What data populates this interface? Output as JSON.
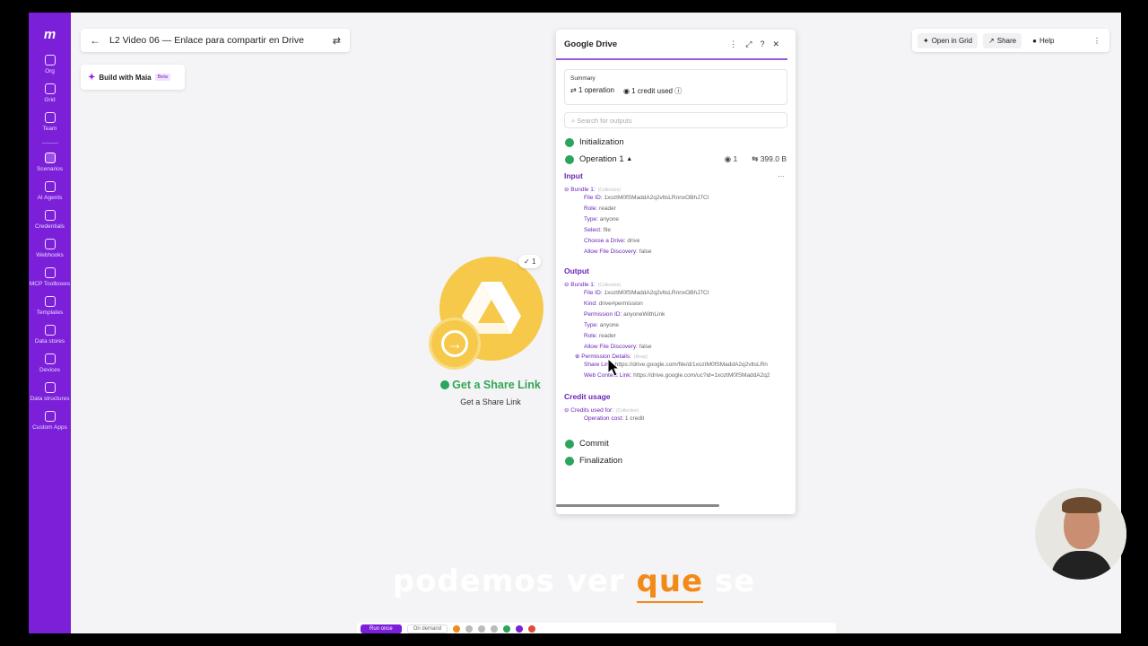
{
  "app": {
    "name": "Make"
  },
  "sidebar": {
    "logo": "m",
    "items": [
      {
        "label": "Org"
      },
      {
        "label": "Grid"
      },
      {
        "label": "Team"
      },
      {
        "label": "Scenarios"
      },
      {
        "label": "AI Agents"
      },
      {
        "label": "Credentials"
      },
      {
        "label": "Webhooks"
      },
      {
        "label": "MCP Toolboxes"
      },
      {
        "label": "Templates"
      },
      {
        "label": "Data stores"
      },
      {
        "label": "Devices"
      },
      {
        "label": "Data structures"
      },
      {
        "label": "Custom Apps"
      }
    ]
  },
  "header": {
    "scenario_title": "L2 Video 06 — Enlace para compartir en Drive",
    "maia_label": "Build with Maia",
    "maia_badge": "Beta",
    "open_in_grid": "Open in Grid",
    "share": "Share",
    "help": "Help"
  },
  "module": {
    "op_count": "1",
    "title": "Get a Share Link",
    "subtitle": "Get a Share Link"
  },
  "panel": {
    "title": "Google Drive",
    "summary_label": "Summary",
    "operations": "1 operation",
    "credits": "1 credit used",
    "search_placeholder": "Search for outputs",
    "initialization": "Initialization",
    "operation_label": "Operation 1",
    "op_views": "1",
    "op_size": "399.0 B",
    "input_label": "Input",
    "input_bundle": "Bundle 1:",
    "input_bundle_type": "(Collection)",
    "input_fields": [
      {
        "k": "File ID:",
        "v": "1xoztM0fSMaddA2q2vltsLRnnxOBhJ7Cl"
      },
      {
        "k": "Role:",
        "v": "reader"
      },
      {
        "k": "Type:",
        "v": "anyone"
      },
      {
        "k": "Select:",
        "v": "file"
      },
      {
        "k": "Choose a Drive:",
        "v": "drive"
      },
      {
        "k": "Allow File Discovery:",
        "v": "false"
      }
    ],
    "output_label": "Output",
    "output_bundle": "Bundle 1:",
    "output_bundle_type": "(Collection)",
    "output_fields": [
      {
        "k": "File ID:",
        "v": "1xoztM0fSMaddA2q2vltsLRnnxOBhJ7Cl"
      },
      {
        "k": "Kind:",
        "v": "drive#permission"
      },
      {
        "k": "Permission ID:",
        "v": "anyoneWithLink"
      },
      {
        "k": "Type:",
        "v": "anyone"
      },
      {
        "k": "Role:",
        "v": "reader"
      },
      {
        "k": "Allow File Discovery:",
        "v": "false"
      }
    ],
    "permission_details": "Permission Details:",
    "permission_details_type": "(Array)",
    "share_link_k": "Share Link:",
    "share_link_v": "https://drive.google.com/file/d/1xoztM0fSMaddA2q2vltsLRn",
    "web_link_k": "Web Content Link:",
    "web_link_v": "https://drive.google.com/uc?id=1xoztM0fSMaddA2q2",
    "credit_usage_label": "Credit usage",
    "credits_used_for": "Credits used for:",
    "credits_used_for_type": "(Collection)",
    "operation_cost_k": "Operation cost:",
    "operation_cost_v": "1 credit",
    "commit": "Commit",
    "finalization": "Finalization"
  },
  "bottombar": {
    "run_once": "Run once",
    "on_demand": "On demand"
  },
  "caption": {
    "before": "podemos ver ",
    "highlight": "que",
    "after": " se"
  },
  "colors": {
    "brand": "#7b1fd9",
    "drive_yellow": "#f6c94a",
    "success": "#2aa55b",
    "caption_highlight": "#f28a1a"
  }
}
